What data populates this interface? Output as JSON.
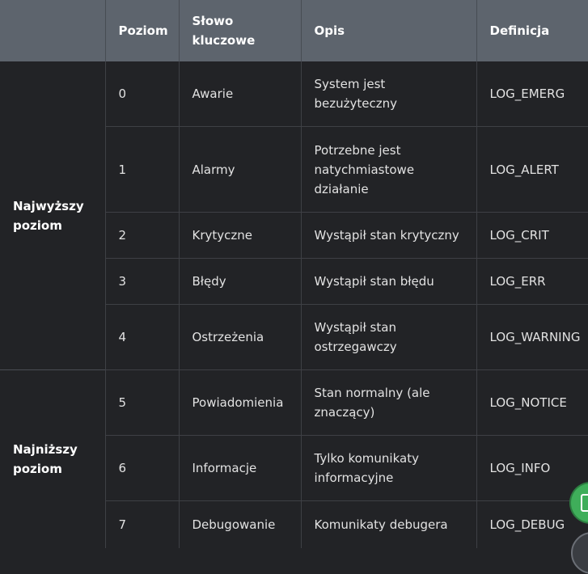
{
  "table": {
    "headers": [
      "",
      "Poziom",
      "Słowo kluczowe",
      "Opis",
      "Definicja"
    ],
    "groups": [
      "Najwyższy poziom",
      "Najniższy poziom"
    ],
    "rows": [
      {
        "level": "0",
        "keyword": "Awarie",
        "description": "System jest bezużyteczny",
        "definition": "LOG_EMERG"
      },
      {
        "level": "1",
        "keyword": "Alarmy",
        "description": "Potrzebne jest natychmiastowe działanie",
        "definition": "LOG_ALERT"
      },
      {
        "level": "2",
        "keyword": "Krytyczne",
        "description": "Wystąpił stan krytyczny",
        "definition": "LOG_CRIT"
      },
      {
        "level": "3",
        "keyword": "Błędy",
        "description": "Wystąpił stan błędu",
        "definition": "LOG_ERR"
      },
      {
        "level": "4",
        "keyword": "Ostrzeżenia",
        "description": "Wystąpił stan ostrzegawczy",
        "definition": "LOG_WARNING"
      },
      {
        "level": "5",
        "keyword": "Powiadomienia",
        "description": "Stan normalny (ale znaczący)",
        "definition": "LOG_NOTICE"
      },
      {
        "level": "6",
        "keyword": "Informacje",
        "description": "Tylko komunikaty informacyjne",
        "definition": "LOG_INFO"
      },
      {
        "level": "7",
        "keyword": "Debugowanie",
        "description": "Komunikaty debugera",
        "definition": "LOG_DEBUG"
      }
    ]
  },
  "colors": {
    "header_bg": "#5d646d",
    "body_bg": "#222326",
    "fab_green": "#3fae5a"
  },
  "icons": {
    "fab_primary": "clipboard-icon",
    "fab_secondary": "circle-button-icon"
  }
}
